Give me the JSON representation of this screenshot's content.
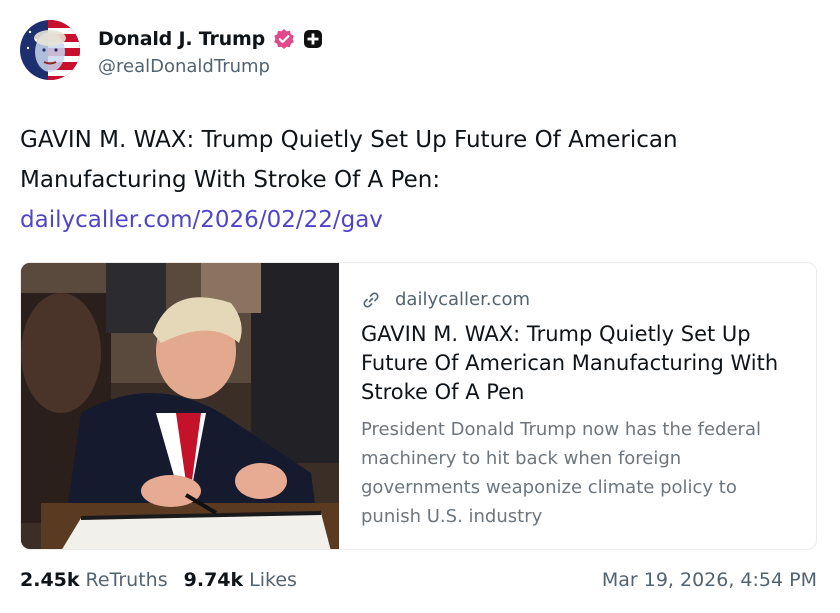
{
  "author": {
    "display_name": "Donald J. Trump",
    "handle": "@realDonaldTrump",
    "avatar_icon": "flag-portrait-avatar",
    "verified_badge_icon": "verified-badge-icon",
    "verified_color": "#e0498a",
    "plus_icon": "plus-square-icon"
  },
  "post": {
    "text": "GAVIN M. WAX: Trump Quietly Set Up Future Of American Manufacturing With Stroke Of A Pen:",
    "link": "dailycaller.com/2026/02/22/gav",
    "link_color": "#4f46c7"
  },
  "card": {
    "image_icon": "signing-photo-image",
    "link_icon": "link-icon",
    "domain": "dailycaller.com",
    "title": "GAVIN M. WAX: Trump Quietly Set Up Future Of American Manufacturing With Stroke Of A Pen",
    "description": "President Donald Trump now has the federal machinery to hit back when foreign governments weaponize climate policy to punish U.S. industry"
  },
  "stats": {
    "retruths_count": "2.45k",
    "retruths_label": "ReTruths",
    "likes_count": "9.74k",
    "likes_label": "Likes"
  },
  "timestamp": "Mar 19, 2026, 4:54 PM"
}
